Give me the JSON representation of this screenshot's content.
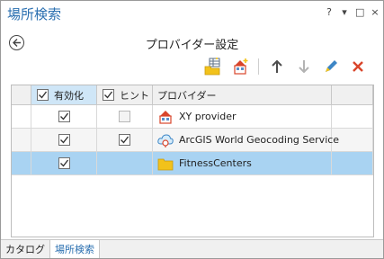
{
  "window": {
    "title": "場所検索",
    "controls": [
      "?",
      "▾",
      "□",
      "×"
    ]
  },
  "page": {
    "heading": "プロバイダー設定"
  },
  "toolbar": {
    "icons": [
      "add-table-locator-icon",
      "add-building-locator-icon",
      "move-up-icon",
      "move-down-icon",
      "edit-icon",
      "remove-icon"
    ]
  },
  "grid": {
    "columns": {
      "enabled": "有効化",
      "hint": "ヒント",
      "provider": "プロバイダー"
    },
    "header_enabled_checked": true,
    "header_hint_checked": true,
    "rows": [
      {
        "provider": "XY provider",
        "icon": "xy-provider-icon",
        "enabled": true,
        "hint": false,
        "hint_available": false
      },
      {
        "provider": "ArcGIS World Geocoding Service",
        "icon": "world-geocoding-icon",
        "enabled": true,
        "hint": true,
        "hint_available": true
      },
      {
        "provider": "FitnessCenters",
        "icon": "folder-locator-icon",
        "enabled": true,
        "hint": false,
        "hint_available": false,
        "selected": true
      }
    ]
  },
  "tabs": [
    {
      "label": "カタログ",
      "active": false
    },
    {
      "label": "場所検索",
      "active": true
    }
  ],
  "colors": {
    "accent": "#2a6fb0",
    "selection": "#a9d3f2",
    "header_highlight": "#cfe6f7",
    "remove": "#d9452b",
    "locator_yellow": "#f2c21b"
  }
}
